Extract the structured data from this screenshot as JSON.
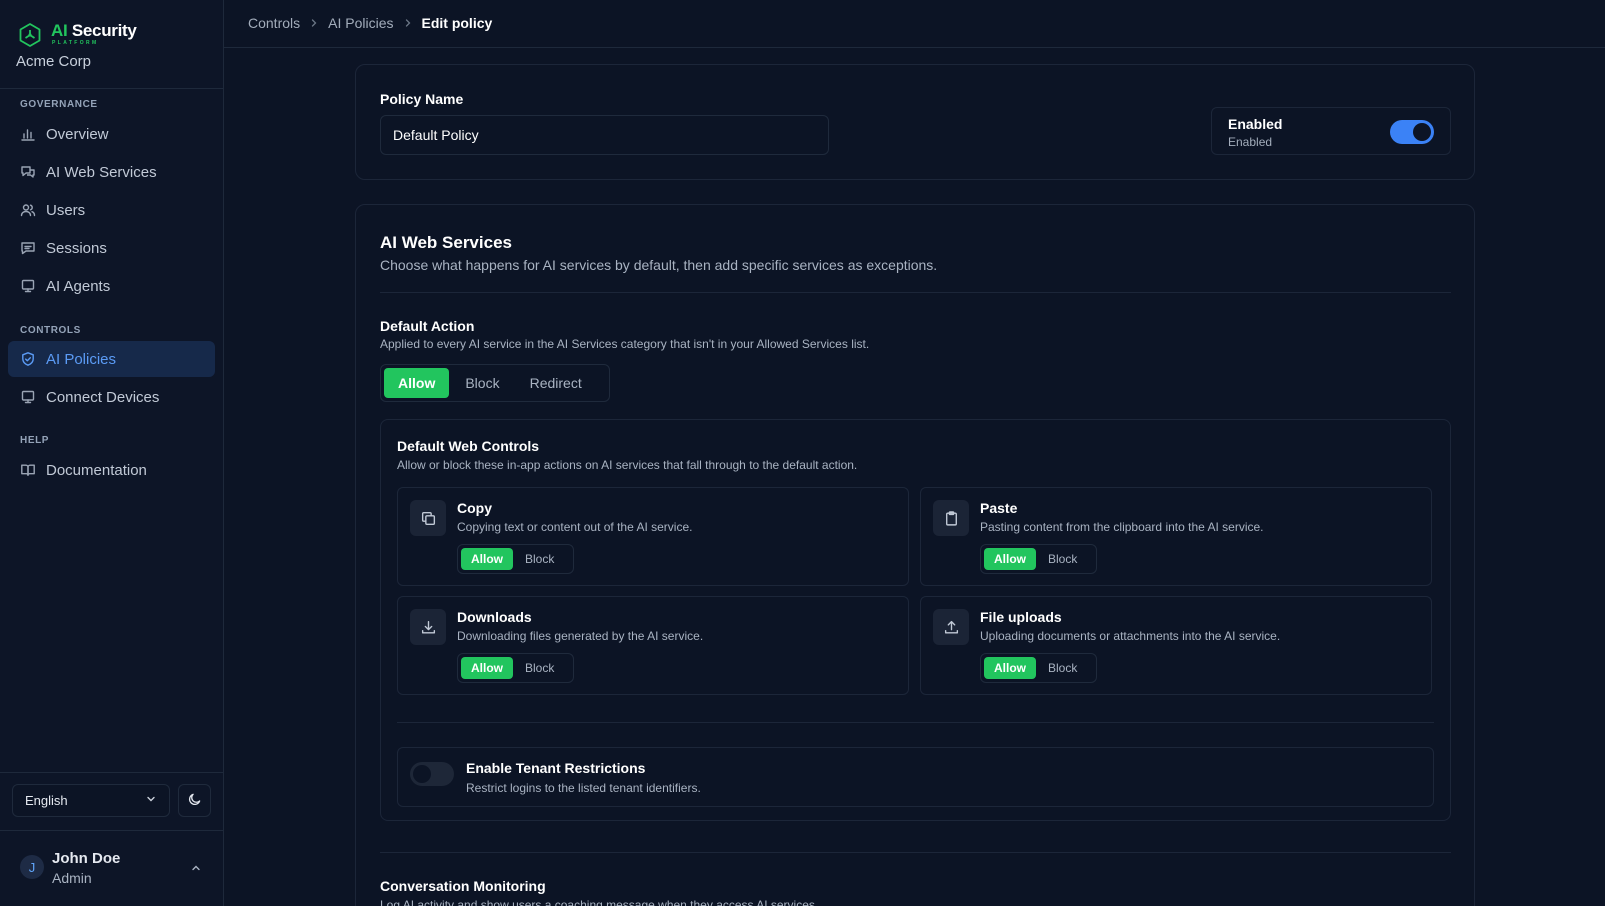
{
  "brand": {
    "ai": "AI",
    "security": "Security",
    "platform": "PLATFORM",
    "org": "Acme Corp"
  },
  "sidebar": {
    "sections": [
      {
        "label": "GOVERNANCE",
        "items": [
          {
            "label": "Overview",
            "icon": "bar-chart-icon"
          },
          {
            "label": "AI Web Services",
            "icon": "chat-bubbles-icon"
          },
          {
            "label": "Users",
            "icon": "users-icon"
          },
          {
            "label": "Sessions",
            "icon": "message-square-icon"
          },
          {
            "label": "AI Agents",
            "icon": "monitor-icon"
          }
        ]
      },
      {
        "label": "CONTROLS",
        "items": [
          {
            "label": "AI Policies",
            "icon": "shield-check-icon",
            "active": true
          },
          {
            "label": "Connect Devices",
            "icon": "monitor-icon"
          }
        ]
      },
      {
        "label": "HELP",
        "items": [
          {
            "label": "Documentation",
            "icon": "book-open-icon"
          }
        ]
      }
    ],
    "language": "English",
    "user": {
      "initial": "J",
      "name": "John Doe",
      "role": "Admin"
    }
  },
  "breadcrumb": [
    "Controls",
    "AI Policies",
    "Edit policy"
  ],
  "policy": {
    "name_label": "Policy Name",
    "name_value": "Default Policy",
    "status_title": "Enabled",
    "status_sub": "Enabled",
    "enabled": true
  },
  "ai_web_services": {
    "title": "AI Web Services",
    "description": "Choose what happens for AI services by default, then add specific services as exceptions.",
    "default_action": {
      "title": "Default Action",
      "description": "Applied to every AI service in the AI Services category that isn't in your Allowed Services list.",
      "options": [
        "Allow",
        "Block",
        "Redirect"
      ],
      "selected": "Allow"
    },
    "web_controls": {
      "title": "Default Web Controls",
      "description": "Allow or block these in-app actions on AI services that fall through to the default action.",
      "allow_label": "Allow",
      "block_label": "Block",
      "items": [
        {
          "title": "Copy",
          "description": "Copying text or content out of the AI service.",
          "icon": "copy-icon",
          "value": "Allow"
        },
        {
          "title": "Paste",
          "description": "Pasting content from the clipboard into the AI service.",
          "icon": "clipboard-icon",
          "value": "Allow"
        },
        {
          "title": "Downloads",
          "description": "Downloading files generated by the AI service.",
          "icon": "download-icon",
          "value": "Allow"
        },
        {
          "title": "File uploads",
          "description": "Uploading documents or attachments into the AI service.",
          "icon": "upload-icon",
          "value": "Allow"
        }
      ]
    },
    "tenant": {
      "title": "Enable Tenant Restrictions",
      "description": "Restrict logins to the listed tenant identifiers.",
      "enabled": false
    }
  },
  "conversation": {
    "title": "Conversation Monitoring",
    "description": "Log AI activity and show users a coaching message when they access AI services."
  },
  "colors": {
    "accent_green": "#22c55e",
    "accent_blue": "#3b82f6",
    "background": "#0c1425"
  }
}
